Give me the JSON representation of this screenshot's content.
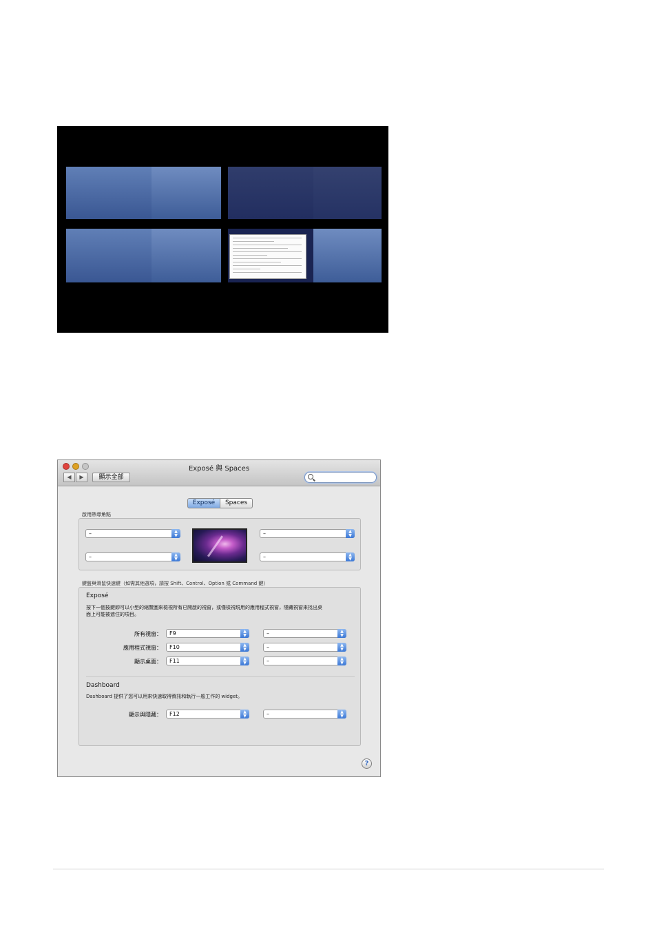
{
  "window": {
    "title": "Exposé 與 Spaces",
    "show_all_label": "顯示全部",
    "back_glyph": "◀",
    "forward_glyph": "▶",
    "search_placeholder": "",
    "help_glyph": "?"
  },
  "tabs": [
    {
      "label": "Exposé",
      "selected": true
    },
    {
      "label": "Spaces",
      "selected": false
    }
  ],
  "hot_corners": {
    "caption": "啟用熱導角點",
    "top_left": "–",
    "top_right": "–",
    "bottom_left": "–",
    "bottom_right": "–"
  },
  "shortcuts_caption": "鍵盤與滑鼠快速鍵（如需其他選項，請按 Shift、Control、Option 或 Command 鍵）",
  "expose": {
    "title": "Exposé",
    "description_line1": "按下一個按鍵即可以小型的縮覽圖來檢視所有已開啟的視窗，或僅檢視現用的應用程式視窗，隱藏視窗來找出桌",
    "description_line2": "面上可能被遮住的項目。",
    "rows": [
      {
        "label": "所有視窗：",
        "key": "F9",
        "mouse": "–"
      },
      {
        "label": "應用程式視窗：",
        "key": "F10",
        "mouse": "–"
      },
      {
        "label": "顯示桌面：",
        "key": "F11",
        "mouse": "–"
      }
    ]
  },
  "dashboard": {
    "title": "Dashboard",
    "description": "Dashboard 提供了您可以用來快速取得資訊和執行一般工作的 widget。",
    "row": {
      "label": "顯示與隱藏：",
      "key": "F12",
      "mouse": "–"
    }
  },
  "colors": {
    "accent": "#3b78d6",
    "close": "#e0443e",
    "minimize": "#dea123",
    "zoom": "#c6c6c6"
  },
  "icons": [
    "search-icon",
    "help-icon",
    "stepper-arrows-icon",
    "back-arrow-icon",
    "forward-arrow-icon"
  ]
}
